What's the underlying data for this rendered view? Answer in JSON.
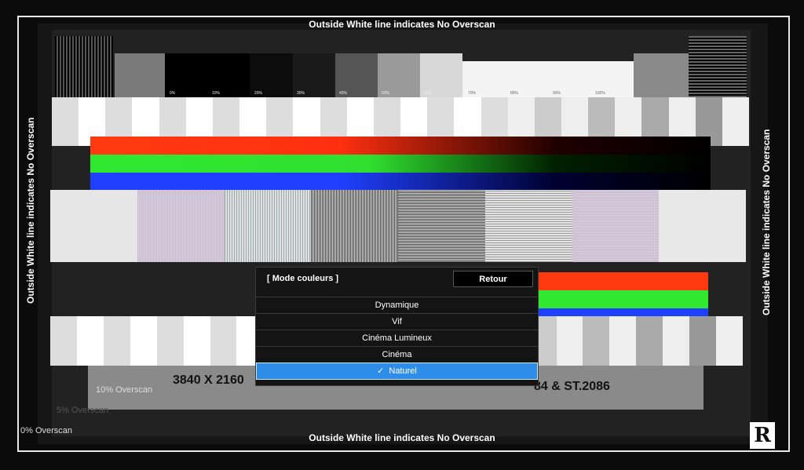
{
  "overscan_labels": {
    "top": "Outside White line indicates No Overscan",
    "bottom": "Outside White line indicates No Overscan",
    "left": "Outside White line indicates No Overscan",
    "right": "Outside White line indicates No Overscan",
    "pct10": "10% Overscan",
    "pct5": "5% Overscan",
    "pct0": "0% Overscan"
  },
  "grayscale_steps": [
    "0%",
    "10%",
    "20%",
    "30%",
    "40%",
    "50%",
    "60%",
    "70%",
    "80%",
    "90%",
    "100%"
  ],
  "resolution_text": "3840 X 2160",
  "standard_text": "84 & ST.2086",
  "menu": {
    "title": "[ Mode couleurs ]",
    "back_label": "Retour",
    "items": [
      {
        "label": "Dynamique",
        "selected": false
      },
      {
        "label": "Vif",
        "selected": false
      },
      {
        "label": "Cinéma Lumineux",
        "selected": false
      },
      {
        "label": "Cinéma",
        "selected": false
      },
      {
        "label": "Naturel",
        "selected": true
      }
    ]
  },
  "logo": "R",
  "colors": {
    "menu_selected": "#2f8dea",
    "red_bar": "#ff3a10",
    "green_bar": "#30e830",
    "blue_bar": "#2040ff"
  }
}
